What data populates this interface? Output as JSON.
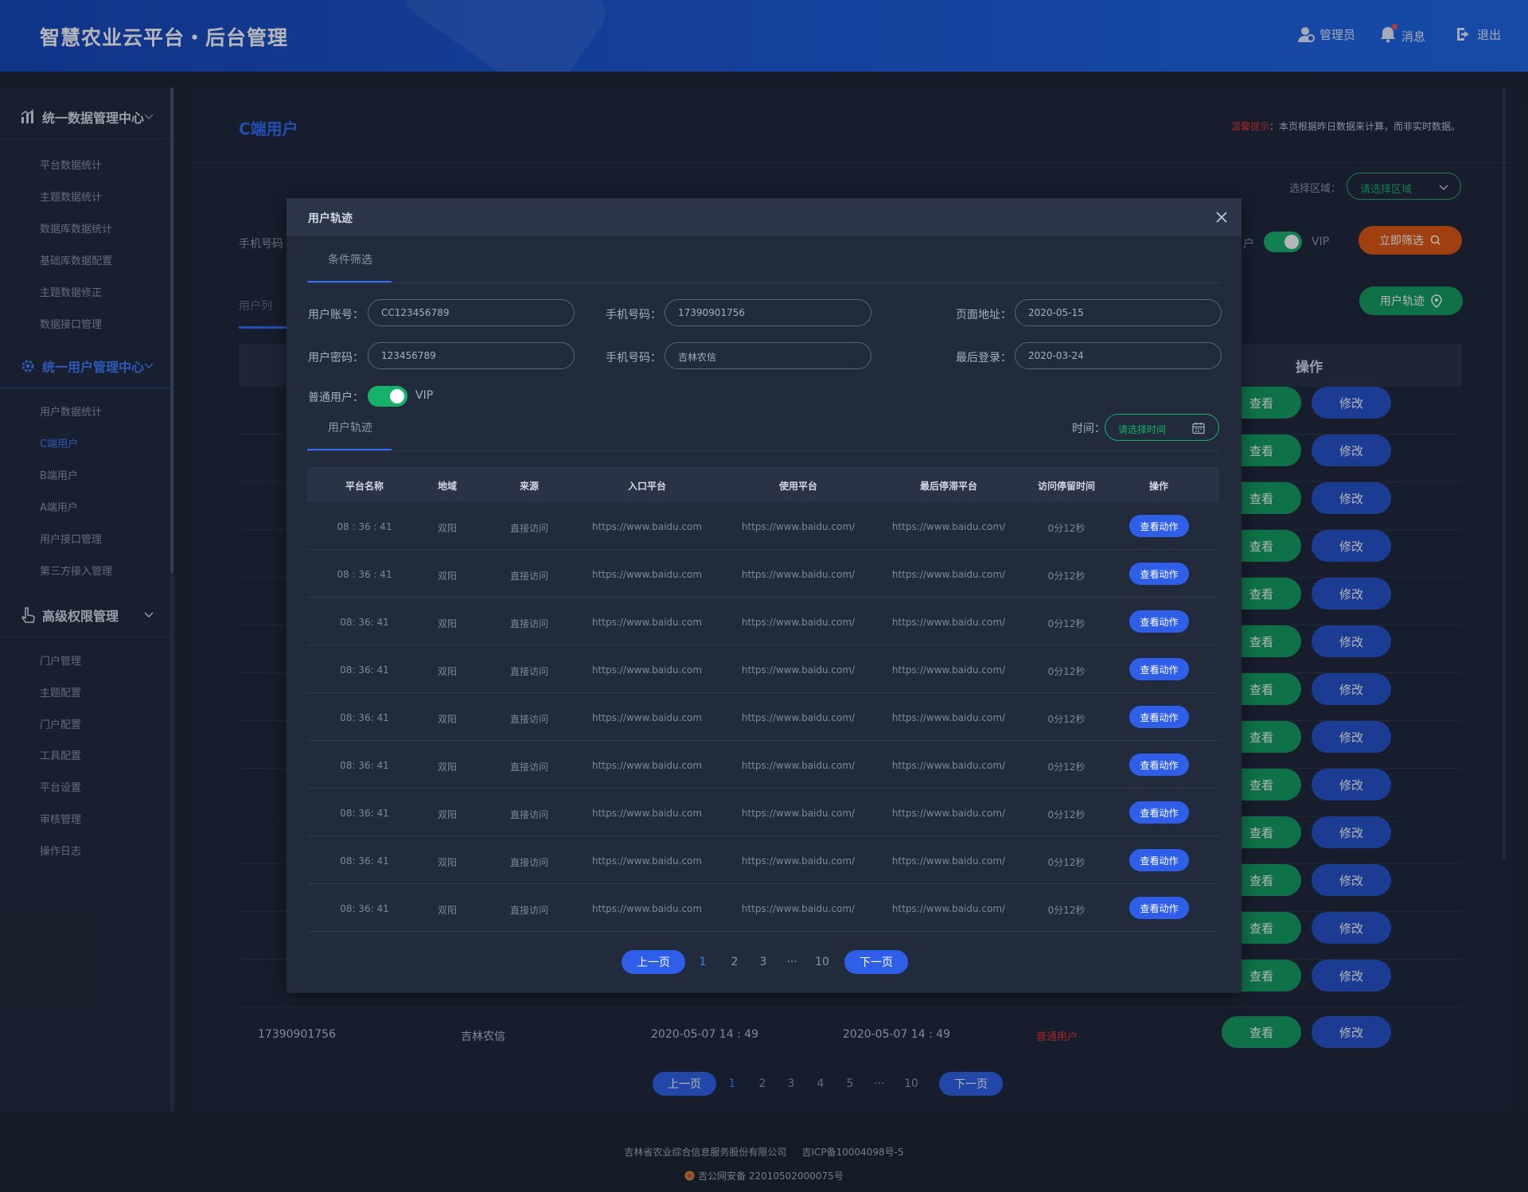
{
  "header": {
    "title": "智慧农业云平台・后台管理",
    "admin": "管理员",
    "messages": "消息",
    "logout": "退出"
  },
  "sidebar": {
    "groups": [
      {
        "label": "统一数据管理中心",
        "icon": "chart-icon",
        "items": [
          "平台数据统计",
          "主题数据统计",
          "数据库数据统计",
          "基础库数据配置",
          "主题数据修正",
          "数据接口管理"
        ]
      },
      {
        "label": "统一用户管理中心",
        "icon": "gear-icon",
        "items": [
          "用户数据统计",
          "C端用户",
          "B端用户",
          "A端用户",
          "用户接口管理",
          "第三方接入管理"
        ],
        "active_item": "C端用户"
      },
      {
        "label": "高级权限管理",
        "icon": "hand-pointer-icon",
        "items": [
          "门户管理",
          "主题配置",
          "门户配置",
          "工具配置",
          "平台设置",
          "审核管理",
          "操作日志"
        ]
      }
    ]
  },
  "page": {
    "title": "C端用户",
    "tip_label": "温馨提示",
    "tip_text": "：本页根据昨日数据来计算，而非实时数据。",
    "region_label": "选择区域：",
    "region_placeholder": "请选择区域",
    "phone_label": "手机号码",
    "user_label": "户",
    "vip_label": "VIP",
    "filter_button": "立即筛选",
    "track_button": "用户轨迹",
    "tab_label": "用户列",
    "op_header": "操作",
    "view_label": "查看",
    "edit_label": "修改",
    "last_row": {
      "phone": "17390901756",
      "bank": "吉林农信",
      "created": "2020-05-07  14 : 49",
      "last_login": "2020-05-07  14 : 49",
      "type": "普通用户",
      "type_color": "#e0342f"
    },
    "pager": {
      "prev": "上一页",
      "next": "下一页",
      "pages": [
        "1",
        "2",
        "3",
        "4",
        "5",
        "···",
        "10"
      ],
      "current": "1"
    }
  },
  "modal": {
    "title": "用户轨迹",
    "tab_filter": "条件筛选",
    "tab_track": "用户轨迹",
    "fields": {
      "account_label": "用户账号：",
      "account_value": "CC123456789",
      "phone_label": "手机号码：",
      "phone_value": "17390901756",
      "page_label": "页面地址：",
      "page_value": "2020-05-15",
      "password_label": "用户密码：",
      "password_value": "123456789",
      "phone2_label": "手机号码：",
      "phone2_value": "吉林农信",
      "last_login_label": "最后登录：",
      "last_login_value": "2020-03-24"
    },
    "normal_user_label": "普通用户：",
    "vip_label": "VIP",
    "time_label": "时间：",
    "time_placeholder": "请选择时间",
    "table": {
      "headers": [
        "平台名称",
        "地域",
        "来源",
        "入口平台",
        "使用平台",
        "最后停滞平台",
        "访问停留时间",
        "操作"
      ],
      "rows": [
        [
          "08 : 36 : 41",
          "双阳",
          "直接访问",
          "https://www.baidu.com",
          "https://www.baidu.com/",
          "https://www.baidu.com/",
          "0分12秒",
          "查看动作"
        ],
        [
          "08 : 36 : 41",
          "双阳",
          "直接访问",
          "https://www.baidu.com",
          "https://www.baidu.com/",
          "https://www.baidu.com/",
          "0分12秒",
          "查看动作"
        ],
        [
          "08:  36:  41",
          "双阳",
          "直接访问",
          "https://www.baidu.com",
          "https://www.baidu.com/",
          "https://www.baidu.com/",
          "0分12秒",
          "查看动作"
        ],
        [
          "08:  36:  41",
          "双阳",
          "直接访问",
          "https://www.baidu.com",
          "https://www.baidu.com/",
          "https://www.baidu.com/",
          "0分12秒",
          "查看动作"
        ],
        [
          "08:  36:  41",
          "双阳",
          "直接访问",
          "https://www.baidu.com",
          "https://www.baidu.com/",
          "https://www.baidu.com/",
          "0分12秒",
          "查看动作"
        ],
        [
          "08:  36:  41",
          "双阳",
          "直接访问",
          "https://www.baidu.com",
          "https://www.baidu.com/",
          "https://www.baidu.com/",
          "0分12秒",
          "查看动作"
        ],
        [
          "08:  36:  41",
          "双阳",
          "直接访问",
          "https://www.baidu.com",
          "https://www.baidu.com/",
          "https://www.baidu.com/",
          "0分12秒",
          "查看动作"
        ],
        [
          "08:  36:  41",
          "双阳",
          "直接访问",
          "https://www.baidu.com",
          "https://www.baidu.com/",
          "https://www.baidu.com/",
          "0分12秒",
          "查看动作"
        ],
        [
          "08:  36:  41",
          "双阳",
          "直接访问",
          "https://www.baidu.com",
          "https://www.baidu.com/",
          "https://www.baidu.com/",
          "0分12秒",
          "查看动作"
        ]
      ]
    },
    "pager": {
      "prev": "上一页",
      "next": "下一页",
      "pages": [
        "1",
        "2",
        "3",
        "···",
        "10"
      ],
      "current": "1"
    }
  },
  "footer": {
    "company": "吉林省农业综合信息服务股份有限公司",
    "icp": "吉ICP备10004098号-5",
    "police": "吉公网安备 22010502000075号"
  }
}
